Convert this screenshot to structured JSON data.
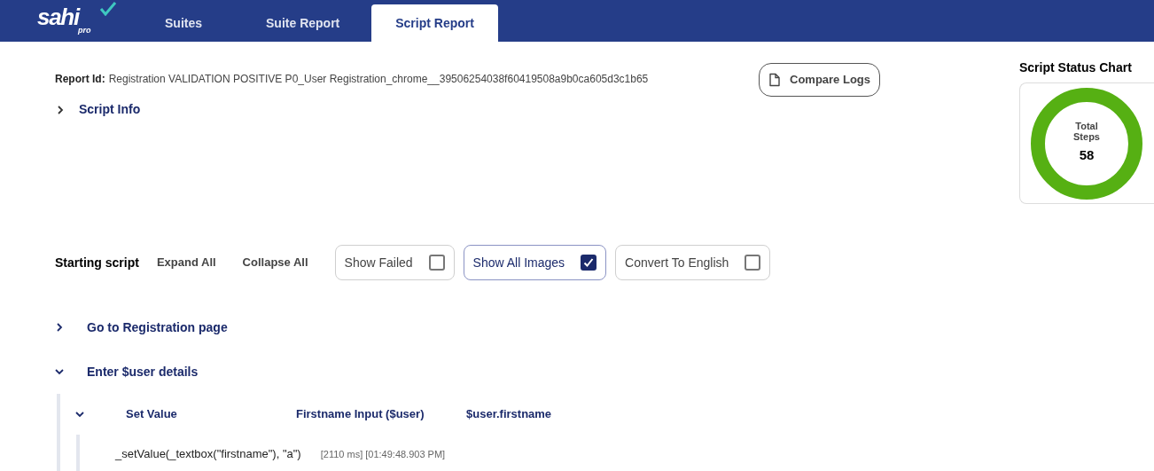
{
  "logo": {
    "name": "sahi",
    "sub": "pro"
  },
  "tabs": [
    {
      "label": "Suites",
      "selected": false
    },
    {
      "label": "Suite Report",
      "selected": false
    },
    {
      "label": "Script Report",
      "selected": true
    }
  ],
  "report": {
    "label": "Report Id:",
    "value": "Registration VALIDATION POSITIVE P0_User Registration_chrome__39506254038f60419508a9b0ca605d3c1b65",
    "compare_button": "Compare Logs"
  },
  "script_info": {
    "label": "Script Info",
    "expanded": false
  },
  "status_chart": {
    "title": "Script Status Chart",
    "center_label": "Total Steps",
    "center_value": "58"
  },
  "toolbar": {
    "title": "Starting script",
    "buttons": [
      "Expand All",
      "Collapse All"
    ],
    "toggles": [
      {
        "label": "Show Failed",
        "checked": false
      },
      {
        "label": "Show All Images",
        "checked": true
      },
      {
        "label": "Convert To English",
        "checked": false
      }
    ]
  },
  "steps": [
    {
      "kind": "group",
      "title": "Go to Registration page",
      "expanded": false
    },
    {
      "kind": "group",
      "title": "Enter $user details",
      "expanded": true,
      "children": [
        {
          "kind": "action",
          "action": "Set Value",
          "target": "Firstname Input ($user)",
          "value": "$user.firstname",
          "expanded": true,
          "children": [
            {
              "kind": "log",
              "code": "_setValue(_textbox(\"firstname\"), \"a\")",
              "timing": "[2110 ms] [01:49:48.903 PM]"
            }
          ]
        }
      ]
    }
  ]
}
